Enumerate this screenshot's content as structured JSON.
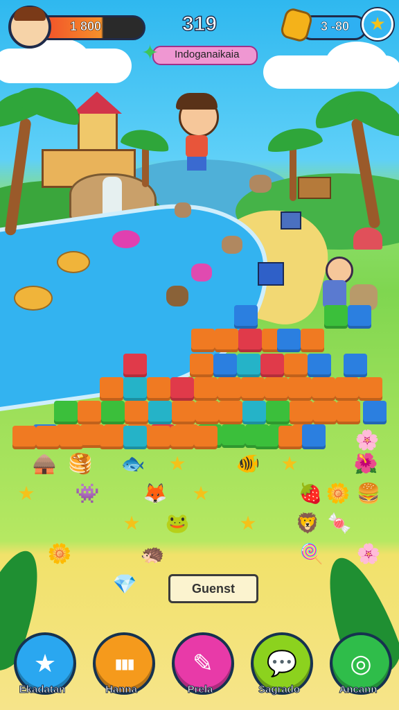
{
  "hud": {
    "coins": "1 800",
    "score": "319",
    "gems": "3 -80",
    "banner": "Indoganaikaia"
  },
  "board": {
    "guest_label": "Guenst"
  },
  "nav": [
    {
      "label": "Ekadatan",
      "icon": "star-icon",
      "color": "#2aa7f0"
    },
    {
      "label": "Hanna",
      "icon": "bars-icon",
      "color": "#f59a1c"
    },
    {
      "label": "Prela",
      "icon": "brush-icon",
      "color": "#e83aa8"
    },
    {
      "label": "Sagrado",
      "icon": "speech-icon",
      "color": "#8cd21e"
    },
    {
      "label": "Ancann",
      "icon": "spiral-icon",
      "color": "#2fbd4a"
    }
  ],
  "colors": {
    "orange": "#f07a22",
    "blue": "#2b7fe0",
    "green": "#3bbf3b",
    "red": "#e03a4a",
    "teal": "#25b3c8"
  }
}
